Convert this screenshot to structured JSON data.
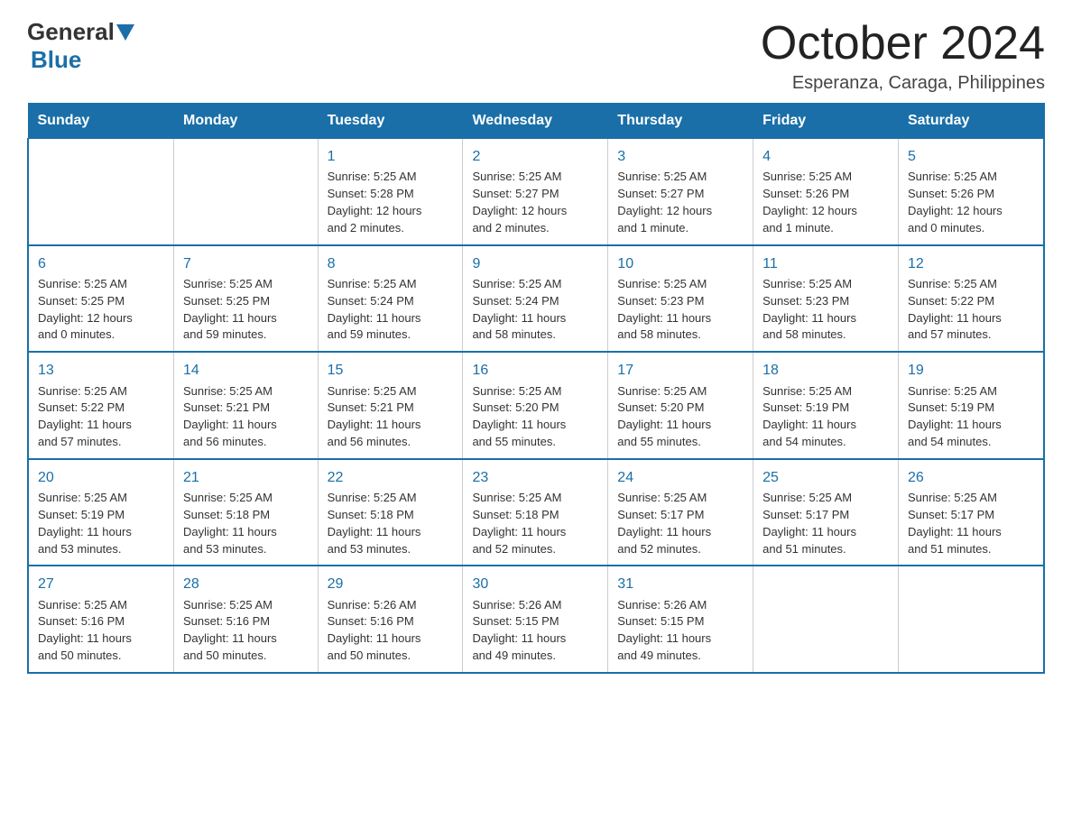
{
  "header": {
    "logo": {
      "general": "General",
      "blue": "Blue"
    },
    "title": "October 2024",
    "location": "Esperanza, Caraga, Philippines"
  },
  "calendar": {
    "days_of_week": [
      "Sunday",
      "Monday",
      "Tuesday",
      "Wednesday",
      "Thursday",
      "Friday",
      "Saturday"
    ],
    "weeks": [
      [
        {
          "day": "",
          "info": ""
        },
        {
          "day": "",
          "info": ""
        },
        {
          "day": "1",
          "info": "Sunrise: 5:25 AM\nSunset: 5:28 PM\nDaylight: 12 hours\nand 2 minutes."
        },
        {
          "day": "2",
          "info": "Sunrise: 5:25 AM\nSunset: 5:27 PM\nDaylight: 12 hours\nand 2 minutes."
        },
        {
          "day": "3",
          "info": "Sunrise: 5:25 AM\nSunset: 5:27 PM\nDaylight: 12 hours\nand 1 minute."
        },
        {
          "day": "4",
          "info": "Sunrise: 5:25 AM\nSunset: 5:26 PM\nDaylight: 12 hours\nand 1 minute."
        },
        {
          "day": "5",
          "info": "Sunrise: 5:25 AM\nSunset: 5:26 PM\nDaylight: 12 hours\nand 0 minutes."
        }
      ],
      [
        {
          "day": "6",
          "info": "Sunrise: 5:25 AM\nSunset: 5:25 PM\nDaylight: 12 hours\nand 0 minutes."
        },
        {
          "day": "7",
          "info": "Sunrise: 5:25 AM\nSunset: 5:25 PM\nDaylight: 11 hours\nand 59 minutes."
        },
        {
          "day": "8",
          "info": "Sunrise: 5:25 AM\nSunset: 5:24 PM\nDaylight: 11 hours\nand 59 minutes."
        },
        {
          "day": "9",
          "info": "Sunrise: 5:25 AM\nSunset: 5:24 PM\nDaylight: 11 hours\nand 58 minutes."
        },
        {
          "day": "10",
          "info": "Sunrise: 5:25 AM\nSunset: 5:23 PM\nDaylight: 11 hours\nand 58 minutes."
        },
        {
          "day": "11",
          "info": "Sunrise: 5:25 AM\nSunset: 5:23 PM\nDaylight: 11 hours\nand 58 minutes."
        },
        {
          "day": "12",
          "info": "Sunrise: 5:25 AM\nSunset: 5:22 PM\nDaylight: 11 hours\nand 57 minutes."
        }
      ],
      [
        {
          "day": "13",
          "info": "Sunrise: 5:25 AM\nSunset: 5:22 PM\nDaylight: 11 hours\nand 57 minutes."
        },
        {
          "day": "14",
          "info": "Sunrise: 5:25 AM\nSunset: 5:21 PM\nDaylight: 11 hours\nand 56 minutes."
        },
        {
          "day": "15",
          "info": "Sunrise: 5:25 AM\nSunset: 5:21 PM\nDaylight: 11 hours\nand 56 minutes."
        },
        {
          "day": "16",
          "info": "Sunrise: 5:25 AM\nSunset: 5:20 PM\nDaylight: 11 hours\nand 55 minutes."
        },
        {
          "day": "17",
          "info": "Sunrise: 5:25 AM\nSunset: 5:20 PM\nDaylight: 11 hours\nand 55 minutes."
        },
        {
          "day": "18",
          "info": "Sunrise: 5:25 AM\nSunset: 5:19 PM\nDaylight: 11 hours\nand 54 minutes."
        },
        {
          "day": "19",
          "info": "Sunrise: 5:25 AM\nSunset: 5:19 PM\nDaylight: 11 hours\nand 54 minutes."
        }
      ],
      [
        {
          "day": "20",
          "info": "Sunrise: 5:25 AM\nSunset: 5:19 PM\nDaylight: 11 hours\nand 53 minutes."
        },
        {
          "day": "21",
          "info": "Sunrise: 5:25 AM\nSunset: 5:18 PM\nDaylight: 11 hours\nand 53 minutes."
        },
        {
          "day": "22",
          "info": "Sunrise: 5:25 AM\nSunset: 5:18 PM\nDaylight: 11 hours\nand 53 minutes."
        },
        {
          "day": "23",
          "info": "Sunrise: 5:25 AM\nSunset: 5:18 PM\nDaylight: 11 hours\nand 52 minutes."
        },
        {
          "day": "24",
          "info": "Sunrise: 5:25 AM\nSunset: 5:17 PM\nDaylight: 11 hours\nand 52 minutes."
        },
        {
          "day": "25",
          "info": "Sunrise: 5:25 AM\nSunset: 5:17 PM\nDaylight: 11 hours\nand 51 minutes."
        },
        {
          "day": "26",
          "info": "Sunrise: 5:25 AM\nSunset: 5:17 PM\nDaylight: 11 hours\nand 51 minutes."
        }
      ],
      [
        {
          "day": "27",
          "info": "Sunrise: 5:25 AM\nSunset: 5:16 PM\nDaylight: 11 hours\nand 50 minutes."
        },
        {
          "day": "28",
          "info": "Sunrise: 5:25 AM\nSunset: 5:16 PM\nDaylight: 11 hours\nand 50 minutes."
        },
        {
          "day": "29",
          "info": "Sunrise: 5:26 AM\nSunset: 5:16 PM\nDaylight: 11 hours\nand 50 minutes."
        },
        {
          "day": "30",
          "info": "Sunrise: 5:26 AM\nSunset: 5:15 PM\nDaylight: 11 hours\nand 49 minutes."
        },
        {
          "day": "31",
          "info": "Sunrise: 5:26 AM\nSunset: 5:15 PM\nDaylight: 11 hours\nand 49 minutes."
        },
        {
          "day": "",
          "info": ""
        },
        {
          "day": "",
          "info": ""
        }
      ]
    ]
  }
}
